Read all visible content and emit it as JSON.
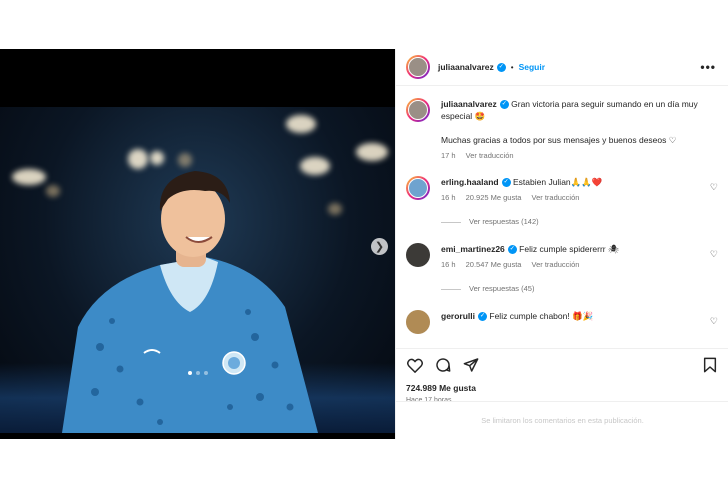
{
  "post": {
    "author": "juliaanalvarez",
    "follow_label": "Seguir",
    "more_label": "•••",
    "caption_line1": "Gran victoria para seguir sumando en un día muy especial 🤩",
    "caption_line2": "Muchas gracias a todos por sus mensajes y buenos deseos ♡",
    "caption_time": "17 h",
    "caption_translate": "Ver traducción",
    "likes": "724.989 Me gusta",
    "posted": "Hace 17 horas",
    "comments_limited": "Se limitaron los comentarios en esta publicación."
  },
  "comments": [
    {
      "user": "erling.haaland",
      "text": "Estabien Julian🙏🙏❤️",
      "time": "16 h",
      "likes": "20.925 Me gusta",
      "translate": "Ver traducción",
      "replies": "Ver respuestas (142)"
    },
    {
      "user": "emi_martinez26",
      "text": "Feliz cumple spidererrr 🕷",
      "time": "16 h",
      "likes": "20.547 Me gusta",
      "translate": "Ver traducción",
      "replies": "Ver respuestas (45)"
    },
    {
      "user": "gerorulli",
      "text": "Feliz cumple chabon! 🎁🎉"
    }
  ],
  "carousel": {
    "slides": 3,
    "active": 1
  },
  "colors": {
    "accent": "#0095f6",
    "muted": "#737373",
    "divider": "#efefef"
  }
}
